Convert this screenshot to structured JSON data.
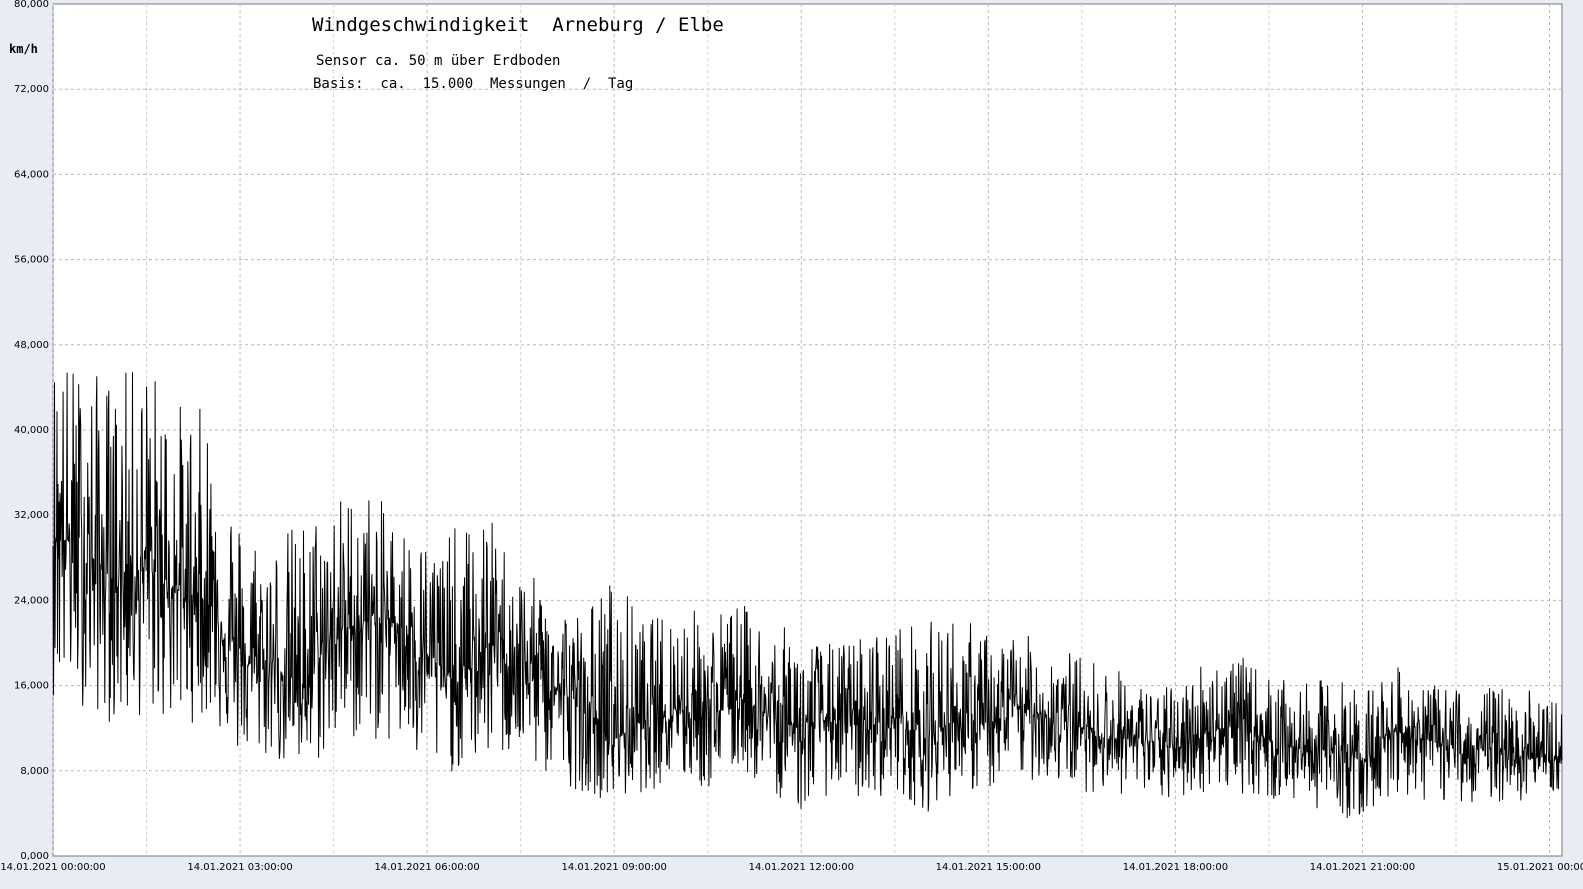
{
  "chart_data": {
    "type": "line",
    "title": "Windgeschwindigkeit  Arneburg / Elbe",
    "subtitle": "Sensor ca. 50 m über Erdboden",
    "basis": "Basis:  ca.  15.000  Messungen  /  Tag",
    "ylabel": "km/h",
    "ylim": [
      0,
      80
    ],
    "y_ticks": [
      "0,000",
      "8,000",
      "16,000",
      "24,000",
      "32,000",
      "40,000",
      "48,000",
      "56,000",
      "64,000",
      "72,000",
      "80,000"
    ],
    "x_ticks": [
      {
        "hour": 0,
        "label": "14.01.2021  00:00:00"
      },
      {
        "hour": 3,
        "label": "14.01.2021  03:00:00"
      },
      {
        "hour": 6,
        "label": "14.01.2021  06:00:00"
      },
      {
        "hour": 9,
        "label": "14.01.2021  09:00:00"
      },
      {
        "hour": 12,
        "label": "14.01.2021  12:00:00"
      },
      {
        "hour": 15,
        "label": "14.01.2021  15:00:00"
      },
      {
        "hour": 18,
        "label": "14.01.2021  18:00:00"
      },
      {
        "hour": 21,
        "label": "14.01.2021  21:00:00"
      },
      {
        "hour": 24,
        "label": "15.01.2021  00:00:00"
      }
    ],
    "x_range_hours": [
      0,
      24.2
    ],
    "grid": true,
    "series": [
      {
        "color": "#000000",
        "envelope_hour": [
          0,
          0.5,
          1,
          1.5,
          2,
          2.5,
          3,
          3.5,
          4,
          4.5,
          5,
          5.5,
          6,
          6.5,
          7,
          7.5,
          8,
          8.5,
          9,
          9.5,
          10,
          10.5,
          11,
          11.5,
          12,
          12.5,
          13,
          13.5,
          14,
          14.5,
          15,
          15.5,
          16,
          16.5,
          17,
          17.5,
          18,
          18.5,
          19,
          19.5,
          20,
          20.5,
          21,
          21.5,
          22,
          22.5,
          23,
          23.5,
          24,
          24.2
        ],
        "envelope_mean": [
          31,
          28,
          26,
          27,
          25,
          24,
          18,
          18,
          16,
          21,
          22,
          22,
          19,
          16,
          20,
          18,
          16,
          14,
          11,
          13,
          14,
          13,
          15,
          13,
          12,
          13,
          12,
          13,
          11,
          13,
          12,
          14,
          13,
          12,
          11,
          11,
          10,
          12,
          12,
          11,
          10,
          10,
          9,
          12,
          11,
          10,
          10,
          10,
          9,
          9
        ],
        "envelope_max": [
          48,
          46,
          45,
          47,
          43,
          42,
          32,
          30,
          32,
          34,
          35,
          32,
          30,
          31,
          32,
          27,
          25,
          23,
          27,
          22,
          24,
          23,
          24,
          22,
          21,
          20,
          21,
          22,
          22,
          23,
          21,
          21,
          20,
          19,
          18,
          16,
          16,
          19,
          19,
          17,
          16,
          17,
          16,
          18,
          16,
          16,
          16,
          16,
          15,
          15
        ],
        "envelope_min": [
          15,
          14,
          12,
          13,
          12,
          13,
          9,
          9,
          7,
          10,
          11,
          10,
          7,
          8,
          9,
          9,
          7,
          6,
          5,
          6,
          7,
          6,
          8,
          6,
          4,
          6,
          5,
          6,
          4,
          6,
          6,
          7,
          7,
          6,
          6,
          5,
          5,
          6,
          6,
          5,
          5,
          4,
          3,
          6,
          5,
          5,
          5,
          5,
          6,
          6
        ]
      }
    ]
  }
}
